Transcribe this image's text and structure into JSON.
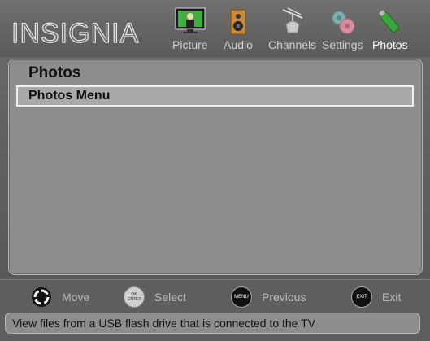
{
  "brand": {
    "logo_text": "INSIGNIA"
  },
  "tabs": [
    {
      "label": "Picture",
      "icon": "picture-icon"
    },
    {
      "label": "Audio",
      "icon": "audio-icon"
    },
    {
      "label": "Channels",
      "icon": "channels-icon"
    },
    {
      "label": "Settings",
      "icon": "settings-icon"
    },
    {
      "label": "Photos",
      "icon": "photos-icon",
      "active": true
    }
  ],
  "panel": {
    "title": "Photos",
    "items": [
      {
        "label": "Photos Menu",
        "selected": true
      }
    ]
  },
  "footer": {
    "hints": [
      {
        "button": "move-dpad-icon",
        "button_text": "",
        "label": "Move"
      },
      {
        "button": "ok-enter-button-icon",
        "button_text": "OK ENTER",
        "label": "Select"
      },
      {
        "button": "menu-button-icon",
        "button_text": "MENU",
        "label": "Previous"
      },
      {
        "button": "exit-button-icon",
        "button_text": "EXIT",
        "label": "Exit"
      }
    ],
    "status": "View files from a USB flash drive that is connected to the TV"
  },
  "colors": {
    "background": "#5a5a5a",
    "panel": "#8d8d8d",
    "selection": "#a9a9a9",
    "text_dim": "#bdbdbd"
  }
}
